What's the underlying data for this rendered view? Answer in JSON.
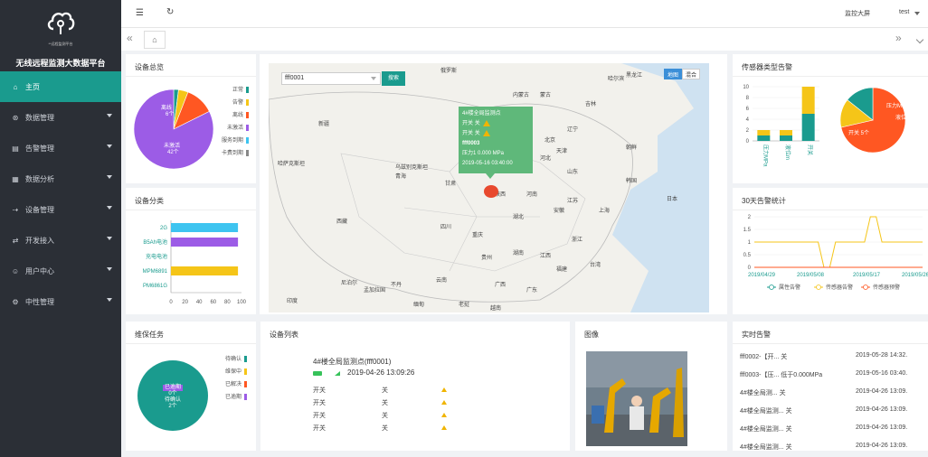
{
  "app": {
    "title": "无线远程监测大数据平台",
    "logo_sub": "**远程监测平台"
  },
  "sidebar": {
    "items": [
      {
        "label": "主页",
        "icon": "home-icon",
        "glyph": "⌂"
      },
      {
        "label": "数据管理",
        "icon": "database-icon",
        "glyph": "⊛"
      },
      {
        "label": "告警管理",
        "icon": "bell-icon",
        "glyph": "▤"
      },
      {
        "label": "数据分析",
        "icon": "chart-icon",
        "glyph": "▦"
      },
      {
        "label": "设备管理",
        "icon": "device-icon",
        "glyph": "⇢"
      },
      {
        "label": "开发接入",
        "icon": "code-icon",
        "glyph": "⇄"
      },
      {
        "label": "用户中心",
        "icon": "user-icon",
        "glyph": "☺"
      },
      {
        "label": "中性管理",
        "icon": "settings-icon",
        "glyph": "⚙"
      }
    ]
  },
  "topbar": {
    "monitor_label": "监控大屏",
    "user": "test",
    "menu_glyph": "☰",
    "refresh_glyph": "↻",
    "prev_glyph": "«",
    "next_glyph": "»",
    "home_glyph": "⌂"
  },
  "overview": {
    "title": "设备总览",
    "legend": [
      {
        "label": "正常",
        "color": "#1a9b8e"
      },
      {
        "label": "告警",
        "color": "#f5c518"
      },
      {
        "label": "离线",
        "color": "#ff5722"
      },
      {
        "label": "未激活",
        "color": "#9c5ce6"
      },
      {
        "label": "服务到期",
        "color": "#3ec4f0"
      },
      {
        "label": "卡费到期",
        "color": "#888888"
      }
    ],
    "slices": [
      {
        "label": "正常",
        "value": 1
      },
      {
        "label": "告警",
        "value": 2
      },
      {
        "label": "离线",
        "value": 6
      },
      {
        "label": "未激活",
        "value": 42
      },
      {
        "label": "服务到期",
        "value": 0
      },
      {
        "label": "卡费到期",
        "value": 0
      }
    ],
    "inner_labels": [
      "离线",
      "6个",
      "未激活",
      "42个"
    ]
  },
  "category": {
    "title": "设备分类",
    "chart_data": {
      "type": "bar",
      "orientation": "horizontal",
      "categories": [
        "2G",
        "B5Ah电池",
        "充电电池",
        "MPM6891",
        "PM6861G"
      ],
      "values": [
        95,
        95,
        0,
        95,
        0
      ],
      "colors": [
        "#3ec4f0",
        "#9c5ce6",
        "#1a9b8e",
        "#f5c518",
        "#888888"
      ],
      "xlim": [
        0,
        100
      ],
      "ticks": [
        "0",
        "20",
        "40",
        "60",
        "80",
        "100"
      ]
    }
  },
  "map": {
    "select_value": "fff0001",
    "search_label": "搜索",
    "type_options": [
      "地图",
      "混合"
    ],
    "labels": [
      "俄罗斯",
      "哈萨克斯坦",
      "乌兹别克斯坦",
      "蒙古",
      "新疆",
      "甘肃",
      "内蒙古",
      "吉林",
      "辽宁",
      "北京",
      "天津",
      "河北",
      "山西",
      "山东",
      "宁夏",
      "陕西",
      "河南",
      "江苏",
      "安徽",
      "湖北",
      "上海",
      "浙江",
      "四川",
      "重庆",
      "湖南",
      "江西",
      "福建",
      "贵州",
      "云南",
      "广西",
      "广东",
      "台湾",
      "西藏",
      "青海",
      "尼泊尔",
      "不丹",
      "缅甸",
      "老挝",
      "越南",
      "孟加拉国",
      "印度",
      "朝鲜",
      "韩国",
      "日本",
      "哈尔滨",
      "黑龙江"
    ],
    "popup": {
      "title": "4#楼全局监测点",
      "rows": [
        {
          "name": "开关",
          "value": "关"
        },
        {
          "name": "开关",
          "value": "关"
        }
      ],
      "device": "fff0003",
      "pressure": "压力1   0.000 MPa",
      "time": "2019-05-16 03:40:00"
    }
  },
  "sensor_alarm": {
    "title": "传感器类型告警",
    "chart_data": {
      "type": "bar",
      "stacked": true,
      "categories": [
        "压力MPa",
        "液位m",
        "开关"
      ],
      "series": [
        {
          "name": "正常",
          "values": [
            1,
            1,
            5
          ],
          "color": "#1a9b8e"
        },
        {
          "name": "告警",
          "values": [
            1,
            1,
            5
          ],
          "color": "#f5c518"
        }
      ],
      "ylim": [
        0,
        10
      ],
      "ticks": [
        "0",
        "2",
        "4",
        "6",
        "8",
        "10"
      ]
    },
    "pie": {
      "slices": [
        {
          "label": "开关",
          "value": 5,
          "color": "#ff5722"
        },
        {
          "label": "压力MPa",
          "value": 1,
          "color": "#f5c518"
        },
        {
          "label": "液位m",
          "value": 1,
          "color": "#1a9b8e"
        }
      ],
      "labels": [
        "压力MPa 1个",
        "液位m 1个",
        "开关 5个"
      ]
    }
  },
  "trend": {
    "title": "30天告警统计",
    "chart_data": {
      "type": "line",
      "x": [
        "2019/04/29",
        "2019/05/08",
        "2019/05/17",
        "2019/05/26"
      ],
      "ylim": [
        0,
        2
      ],
      "yticks": [
        "0",
        "0.5",
        "1",
        "1.5",
        "2"
      ],
      "series": [
        {
          "name": "属性告警",
          "color": "#1a9b8e",
          "values": [
            0,
            0,
            0,
            0,
            0,
            0,
            0,
            0,
            0,
            0,
            0,
            0,
            0,
            0,
            0,
            0,
            0,
            0,
            0,
            0,
            0,
            0,
            0,
            0,
            0,
            0,
            0,
            0,
            0,
            0
          ]
        },
        {
          "name": "传感器告警",
          "color": "#f5c518",
          "values": [
            1,
            1,
            1,
            1,
            1,
            1,
            1,
            1,
            1,
            1,
            1,
            1,
            0,
            0,
            1,
            1,
            1,
            1,
            1,
            1,
            2,
            2,
            1,
            1,
            1,
            1,
            1,
            1,
            1,
            1
          ]
        },
        {
          "name": "传感器预警",
          "color": "#ff5722",
          "values": [
            0,
            0,
            0,
            0,
            0,
            0,
            0,
            0,
            0,
            0,
            0,
            0,
            0,
            0,
            0,
            0,
            0,
            0,
            0,
            0,
            0,
            0,
            0,
            0,
            0,
            0,
            0,
            0,
            0,
            0
          ]
        }
      ]
    }
  },
  "maintenance": {
    "title": "维保任务",
    "legend": [
      {
        "label": "待确认",
        "color": "#1a9b8e"
      },
      {
        "label": "维保中",
        "color": "#f5c518"
      },
      {
        "label": "已解决",
        "color": "#ff5722"
      },
      {
        "label": "已逾期",
        "color": "#9c5ce6"
      }
    ],
    "labels": [
      "已逾期",
      "0个",
      "待确认",
      "2个"
    ]
  },
  "device_list": {
    "title": "设备列表",
    "name": "4#楼全局监测点(fff0001)",
    "time": "2019-04-26 13:09:26",
    "rows": [
      {
        "name": "开关",
        "value": "关"
      },
      {
        "name": "开关",
        "value": "关"
      },
      {
        "name": "开关",
        "value": "关"
      },
      {
        "name": "开关",
        "value": "关"
      }
    ]
  },
  "image": {
    "title": "图像"
  },
  "realtime": {
    "title": "实时告警",
    "rows": [
      {
        "text": "fff0002-【开...  关",
        "time": "2019-05-28 14:32."
      },
      {
        "text": "fff0003-【压...  低于0.000MPa",
        "time": "2019-05-16 03:40."
      },
      {
        "text": "4#楼全局测...  关",
        "time": "2019-04-26 13:09."
      },
      {
        "text": "4#楼全局监测...  关",
        "time": "2019-04-26 13:09."
      },
      {
        "text": "4#楼全局监测...  关",
        "time": "2019-04-26 13:09."
      },
      {
        "text": "4#楼全局监测...  关",
        "time": "2019-04-26 13:09."
      }
    ]
  }
}
